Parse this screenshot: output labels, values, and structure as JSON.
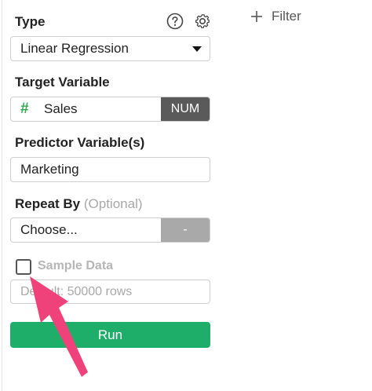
{
  "type_section": {
    "title": "Type",
    "selected_value": "Linear Regression"
  },
  "target_section": {
    "title": "Target Variable",
    "variable_name": "Sales",
    "type_glyph": "#",
    "type_badge": "NUM"
  },
  "predictor_section": {
    "title": "Predictor Variable(s)",
    "value": "Marketing"
  },
  "repeat_section": {
    "title": "Repeat By",
    "optional_label": "(Optional)",
    "value": "Choose...",
    "clear_button": "-"
  },
  "sample_section": {
    "checkbox_label": "Sample Data",
    "checked": false,
    "placeholder": "Default: 50000 rows"
  },
  "run_button_label": "Run",
  "filter": {
    "label": "Filter",
    "icon": "plus-icon"
  },
  "header_icons": [
    "help-icon",
    "gear-icon"
  ],
  "colors": {
    "run_button": "#1fae6a",
    "num_badge": "#5a5a5a",
    "clear_button": "#a9a9a9",
    "hash": "#2fa84f",
    "annotation_arrow": "#f0427a"
  }
}
